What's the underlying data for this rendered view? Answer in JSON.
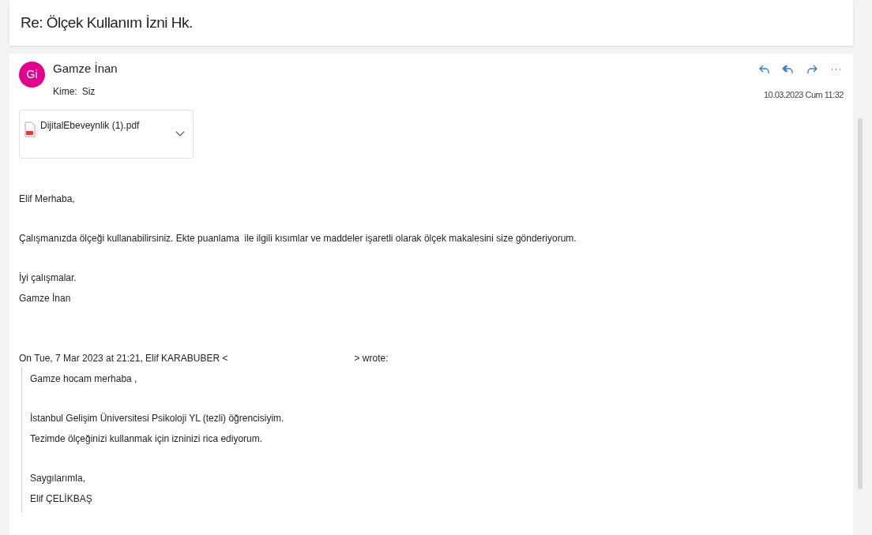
{
  "subject": "Re: Ölçek Kullanım İzni Hk.",
  "message": {
    "avatar": {
      "initials": "Gi",
      "color": "#e3008c"
    },
    "sender": "Gamze İnan",
    "to_label": "Kime:",
    "to": "Siz",
    "date": "10.03.2023 Cum 11:32",
    "attachment": {
      "name": "DijitalEbeveynlik (1).pdf"
    },
    "body": [
      [
        "Elif Merhaba,"
      ],
      [
        "Çalışmanızda ölçeği kullanabilirsiniz. Ekte puanlama  ile ilgili kısımlar ve maddeler işaretli olarak ölçek makalesini size gönderiyorum."
      ],
      [
        "İyi çalışmalar.",
        "Gamze İnan"
      ]
    ],
    "quote_header": {
      "before": "On Tue, 7 Mar 2023 at 21:21, Elif KARABUBER <",
      "after": "> wrote:"
    },
    "quote": [
      [
        "Gamze hocam merhaba ,"
      ],
      [
        "İstanbul Gelişim Üniversitesi Psikoloji YL (tezli) öğrencisiyim.",
        "Tezimde ölçeğinizi kullanmak için izninizi rica ediyorum."
      ],
      [
        "Saygılarımla,",
        "Elif ÇELİKBAŞ"
      ]
    ]
  }
}
